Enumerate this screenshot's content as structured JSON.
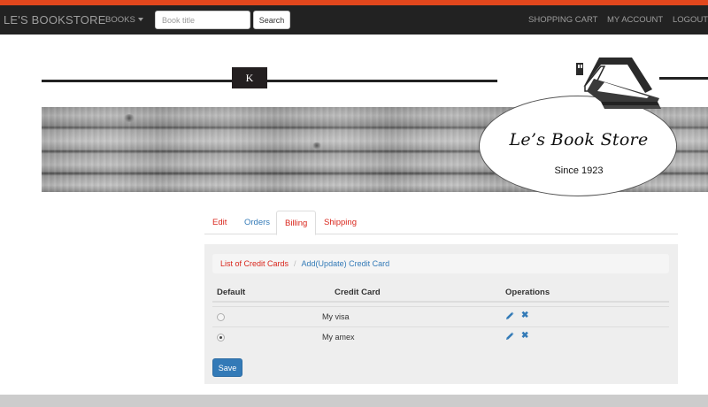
{
  "navbar": {
    "brand": "LE'S BOOKSTORE",
    "books_menu": "BOOKS",
    "search_placeholder": "Book title",
    "search_button": "Search",
    "shopping_cart": "SHOPPING CART",
    "my_account": "MY ACCOUNT",
    "logout": "LOGOUT"
  },
  "header": {
    "k_badge": "K",
    "logo_title": "Le’s Book Store",
    "logo_since": "Since 1923"
  },
  "tabs": [
    {
      "label": "Edit",
      "active": false
    },
    {
      "label": "Orders",
      "active": false
    },
    {
      "label": "Billing",
      "active": true
    },
    {
      "label": "Shipping",
      "active": false
    }
  ],
  "breadcrumb": {
    "item1": "List of Credit Cards",
    "item2": "Add(Update) Credit Card"
  },
  "table": {
    "headers": [
      "Default",
      "Credit Card",
      "Operations"
    ],
    "rows": [
      {
        "default": false,
        "card": "My visa"
      },
      {
        "default": true,
        "card": "My amex"
      }
    ]
  },
  "save_label": "Save",
  "colors": {
    "accent_top": "#e2471d",
    "navbar_bg": "#222222",
    "link_red": "#d9261c",
    "link_blue": "#337ab7",
    "panel_bg": "#eeeeee"
  },
  "icons": {
    "books_caret": "caret-down-icon",
    "edit": "pencil-icon",
    "delete": "x-icon",
    "logo": "house-books-icon"
  }
}
